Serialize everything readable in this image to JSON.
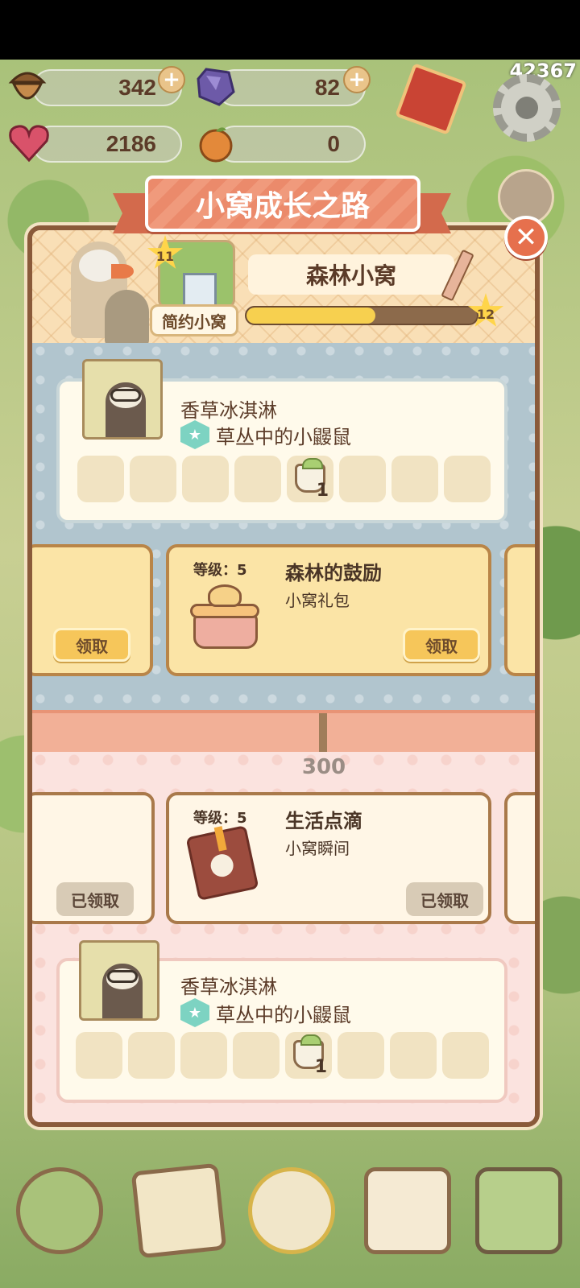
{
  "top_id": "42367",
  "resources": {
    "acorn": {
      "value": "342",
      "icon": "acorn-icon"
    },
    "crystal": {
      "value": "82",
      "icon": "crystal-icon"
    },
    "heart": {
      "value": "2186",
      "icon": "heart-gem-icon"
    },
    "orange": {
      "value": "0",
      "icon": "orange-icon"
    }
  },
  "dialog": {
    "title": "小窝成长之路",
    "close_label": "✕",
    "house": {
      "level": "11",
      "style_label": "简约小窝",
      "name": "森林小窝",
      "next_level": "12",
      "progress_fraction": 0.56
    }
  },
  "sections": {
    "blue": {
      "character": {
        "name": "香草冰淇淋",
        "species": "草丛中的小鼹鼠",
        "slots": [
          "",
          "",
          "",
          "",
          "1",
          "",
          "",
          ""
        ]
      },
      "reward_left": {
        "claim_label": "领取"
      },
      "reward_main": {
        "level_label": "等级：5",
        "title": "森林的鼓励",
        "subtitle": "小窝礼包",
        "claim_label": "领取"
      }
    },
    "milestone": "300",
    "pink": {
      "reward_left": {
        "claim_label": "已领取"
      },
      "reward_main": {
        "level_label": "等级：5",
        "title": "生活点滴",
        "subtitle": "小窝瞬间",
        "claim_label": "已领取"
      },
      "character": {
        "name": "香草冰淇淋",
        "species": "草丛中的小鼹鼠",
        "slots": [
          "",
          "",
          "",
          "",
          "1",
          "",
          "",
          ""
        ]
      }
    }
  },
  "colors": {
    "accent": "#eb8a6b",
    "panel_border": "#8a5a3a",
    "blue_section": "#b1c5ce",
    "pink_section": "#fbe3df",
    "claim": "#f6c65a"
  }
}
